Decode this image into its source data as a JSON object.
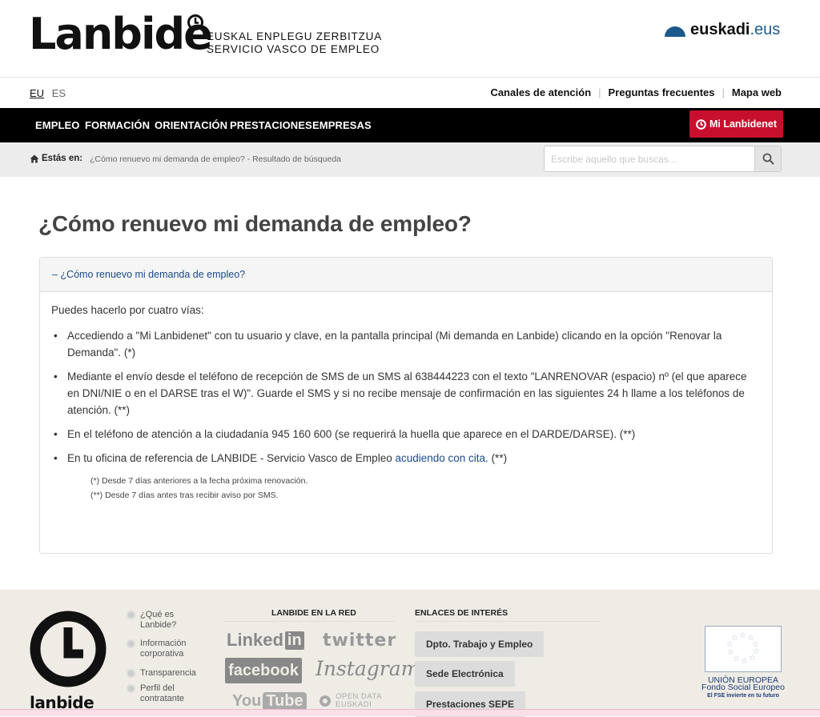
{
  "header": {
    "logo_word": "Lanbide",
    "logo_line1": "EUSKAL ENPLEGU ZERBITZUA",
    "logo_line2": "SERVICIO VASCO DE EMPLEO",
    "euskadi_bold": "euskadi",
    "euskadi_suffix": ".eus"
  },
  "utility": {
    "languages": [
      "EU",
      "ES"
    ],
    "active_language": "EU",
    "links": [
      "Canales de atención",
      "Preguntas frecuentes",
      "Mapa web"
    ]
  },
  "nav": {
    "items": [
      "EMPLEO",
      "FORMACIÓN",
      "ORIENTACIÓN",
      "PRESTACIONES",
      "EMPRESAS"
    ],
    "mi_lanbidenet": "Mi Lanbidenet"
  },
  "breadcrumb": {
    "label": "Estás en:",
    "path": "¿Cómo renuevo mi demanda de empleo? - Resultado de búsqueda"
  },
  "search": {
    "placeholder": "Escribe aquello que buscas..."
  },
  "main": {
    "title": "¿Cómo renuevo mi demanda de empleo?",
    "accordion_title": "– ¿Cómo renuevo mi demanda de empleo?",
    "intro": "Puedes hacerlo por cuatro vías:",
    "items": [
      "Accediendo a \"Mi Lanbidenet\" con tu usuario y clave, en la pantalla principal (Mi demanda en Lanbide) clicando en la opción \"Renovar la Demanda\". (*)",
      "Mediante el envío desde el teléfono de recepción de SMS de un SMS al 638444223 con el texto \"LANRENOVAR (espacio) nº (el que aparece en DNI/NIE o en el DARSE tras el W)\". Guarde el SMS y si no recibe mensaje de confirmación en las siguientes 24 h llame a los teléfonos de atención. (**)",
      "En el teléfono de atención a la ciudadanía 945 160 600 (se requerirá la huella que aparece en el DARDE/DARSE). (**)"
    ],
    "item4_before": "En tu oficina de referencia de LANBIDE - Servicio Vasco de Empleo ",
    "item4_link": "acudiendo con cita.",
    "item4_after": " (**)",
    "note1": "(*)  Desde 7 días anteriores a la fecha próxima renovación.",
    "note2": "(**) Desde 7 días antes tras recibir aviso por SMS."
  },
  "footer": {
    "logo_word": "lanbide",
    "links": [
      "¿Qué es Lanbide?",
      "Información corporativa",
      "Transparencia",
      "Perfil del contratante"
    ],
    "red_title": "LANBIDE EN LA RED",
    "social": {
      "linkedin": "Linked",
      "linkedin_in": "in",
      "twitter": "twitter",
      "facebook": "facebook",
      "instagram": "Instagram",
      "youtube": "You",
      "youtube_tube": "Tube",
      "opendata1": "OPEN DATA",
      "opendata2": "EUSKADI"
    },
    "enlaces_title": "ENLACES DE INTERÉS",
    "enlaces": [
      "Dpto. Trabajo y Empleo",
      "Sede Electrónica",
      "Prestaciones SEPE"
    ],
    "eu_line1": "UNIÓN EUROPEA",
    "eu_line2": "Fondo Social Europeo",
    "eu_line3": "El FSE invierte en tu futuro"
  }
}
